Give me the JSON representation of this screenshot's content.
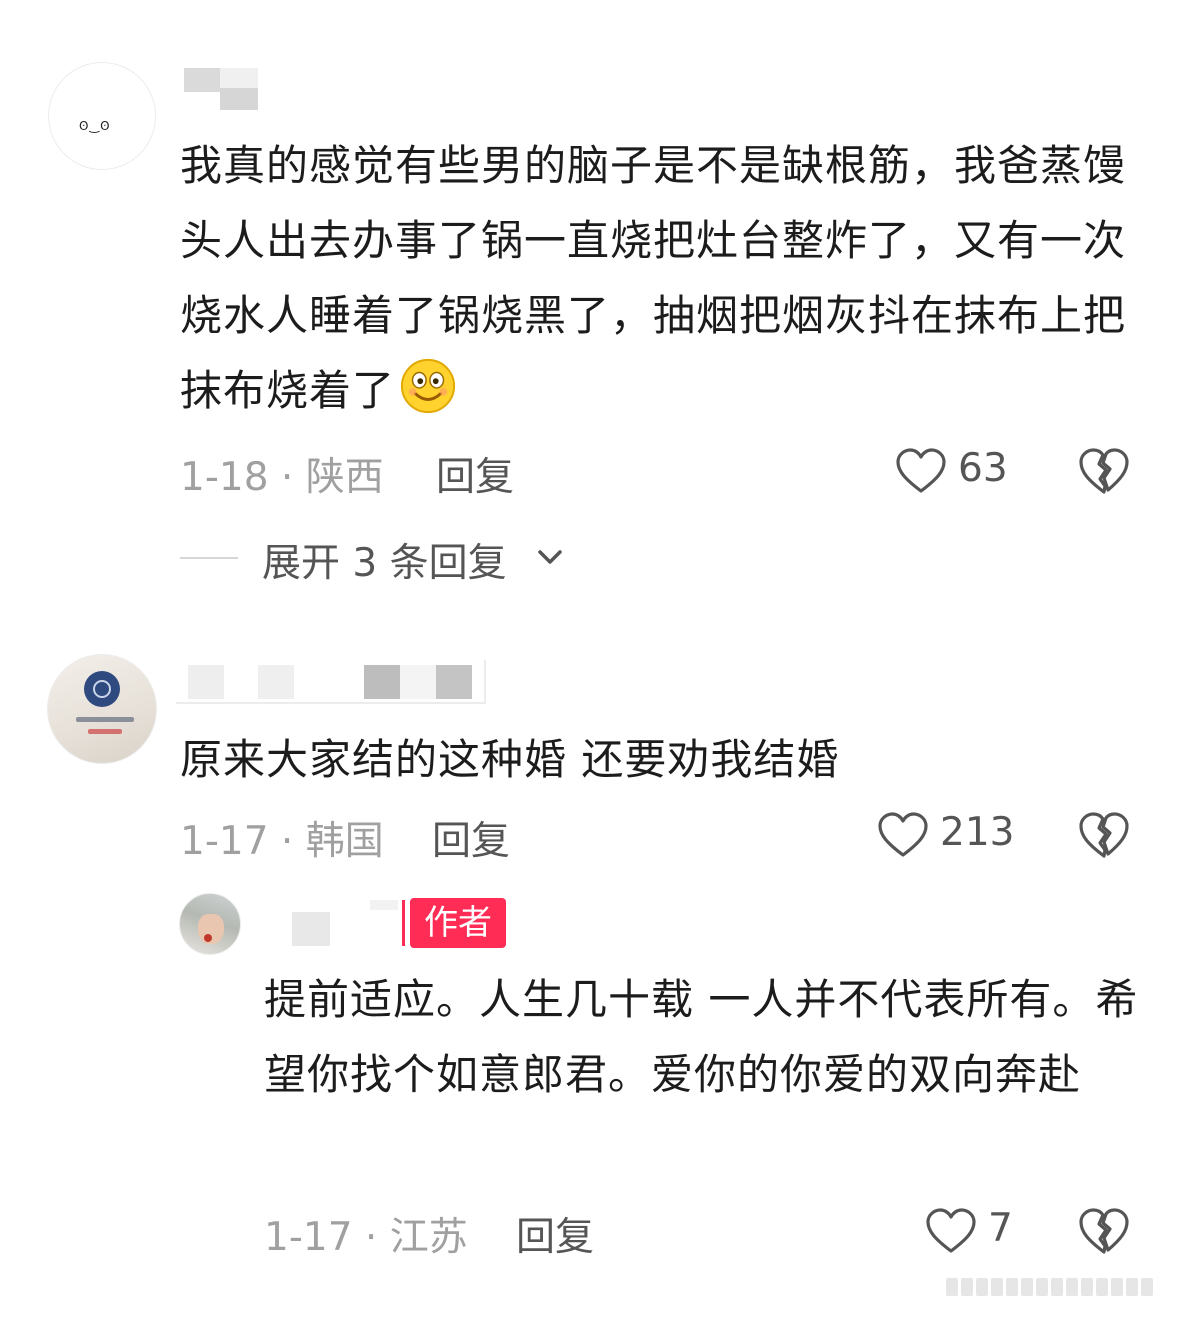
{
  "comments": [
    {
      "text": "我真的感觉有些男的脑子是不是缺根筋，我爸蒸馒头人出去办事了锅一直烧把灶台整炸了，又有一次烧水人睡着了锅烧黑了，抽烟把烟灰抖在抹布上把抹布烧着了",
      "emoji": "smile-emoji",
      "date": "1-18",
      "location": "陕西",
      "reply_label": "回复",
      "likes": "63",
      "expand_label": "展开 3 条回复"
    },
    {
      "text": "原来大家结的这种婚  还要劝我结婚",
      "date": "1-17",
      "location": "韩国",
      "reply_label": "回复",
      "likes": "213",
      "replies": [
        {
          "author_tag": "作者",
          "text": "提前适应。人生几十载 一人并不代表所有。希望你找个如意郎君。爱你的你爱的双向奔赴",
          "date": "1-17",
          "location": "江苏",
          "reply_label": "回复",
          "likes": "7"
        }
      ]
    }
  ],
  "colors": {
    "author_tag_bg": "#ff2c55",
    "meta_text": "#a0a0a0",
    "action_text": "#555555"
  }
}
